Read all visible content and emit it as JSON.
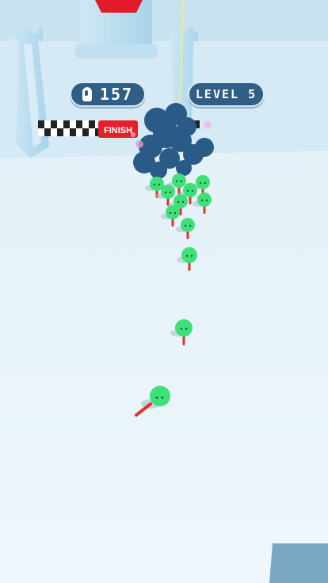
{
  "hud": {
    "player_count": "157",
    "level_label": "LEVEL 5"
  },
  "track": {
    "finish_label": "FINISH"
  },
  "colors": {
    "sky": "#dcedf6",
    "ground": "#e9f4f9",
    "castle": "#b8dcef",
    "castle_roof": "#e11b2a",
    "hud_bg": "#2f5f86",
    "finish_banner": "#e5202c",
    "enemy_blob": "#2a5a86",
    "player": "#3ee07a",
    "weapon": "#e0332b"
  },
  "icons": [
    "person-icon",
    "finish-flag-icon"
  ]
}
